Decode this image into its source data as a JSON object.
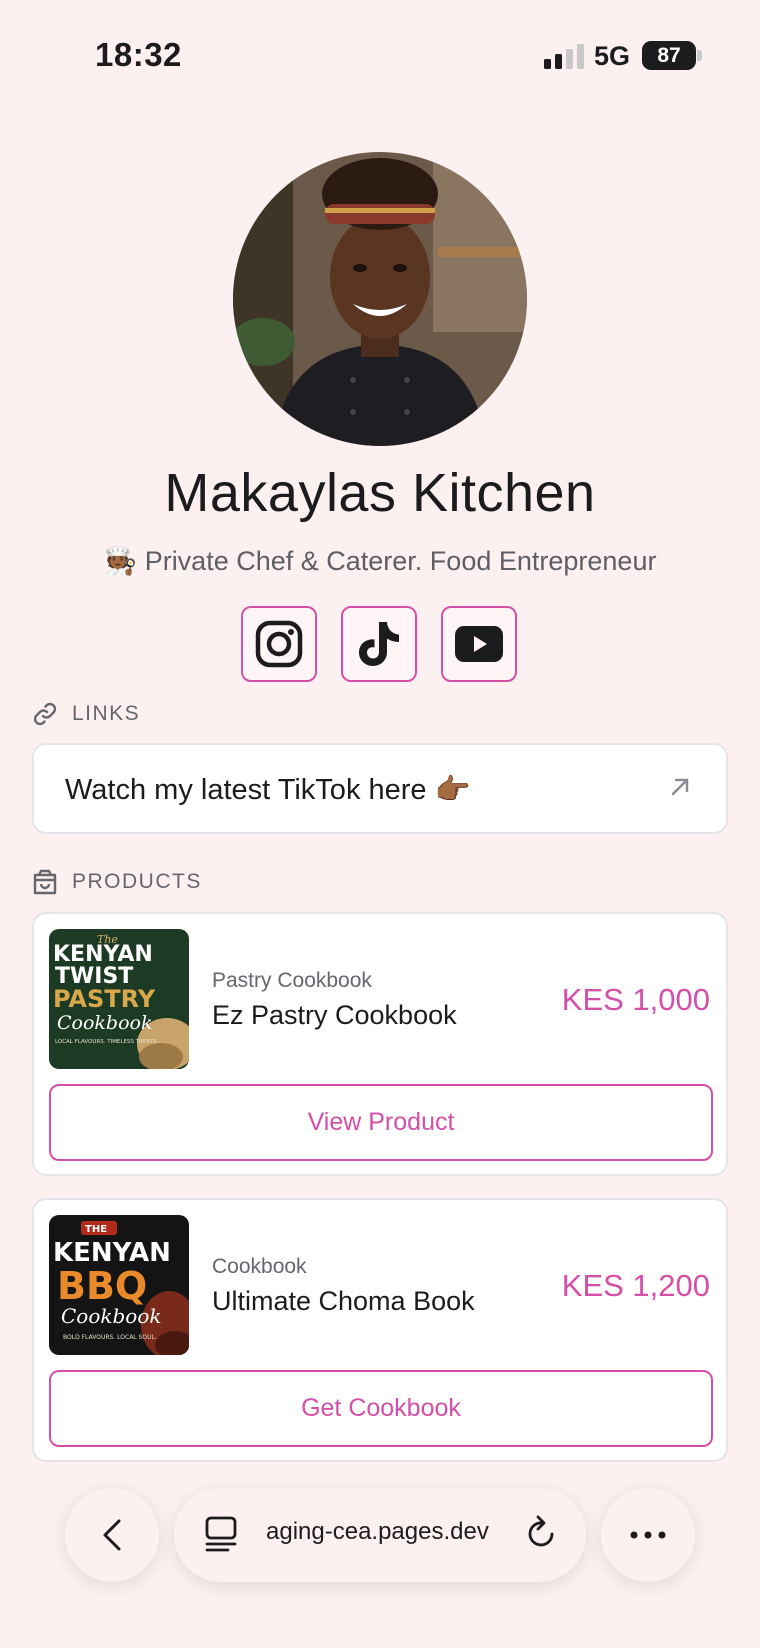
{
  "status_bar": {
    "time": "18:32",
    "network": "5G",
    "battery": "87"
  },
  "profile": {
    "name": "Makaylas Kitchen",
    "bio_emoji": "🧑🏾‍🍳",
    "bio": "Private Chef & Caterer. Food Entrepreneur"
  },
  "socials": [
    {
      "name": "instagram-icon"
    },
    {
      "name": "tiktok-icon"
    },
    {
      "name": "youtube-icon"
    }
  ],
  "links_section": {
    "label": "LINKS"
  },
  "links": [
    {
      "text": "Watch my latest TikTok here 👉🏾"
    }
  ],
  "products_section": {
    "label": "PRODUCTS"
  },
  "products": [
    {
      "category": "Pastry Cookbook",
      "name": "Ez Pastry Cookbook",
      "price": "KES 1,000",
      "button": "View Product",
      "cover": {
        "line1": "The",
        "line2": "KENYAN",
        "line3": "TWIST",
        "line4": "PASTRY",
        "line5": "Cookbook",
        "tagline": "LOCAL FLAVOURS. TIMELESS TREATS."
      }
    },
    {
      "category": "Cookbook",
      "name": "Ultimate Choma Book",
      "price": "KES 1,200",
      "button": "Get Cookbook",
      "cover": {
        "line1": "THE",
        "line2": "KENYAN",
        "line3": "BBQ",
        "line4": "Cookbook",
        "tagline": "BOLD FLAVOURS. LOCAL SOUL."
      }
    }
  ],
  "browser": {
    "url": "aging-cea.pages.dev"
  },
  "colors": {
    "accent": "#d44fa8",
    "background": "#fdf0f0"
  }
}
